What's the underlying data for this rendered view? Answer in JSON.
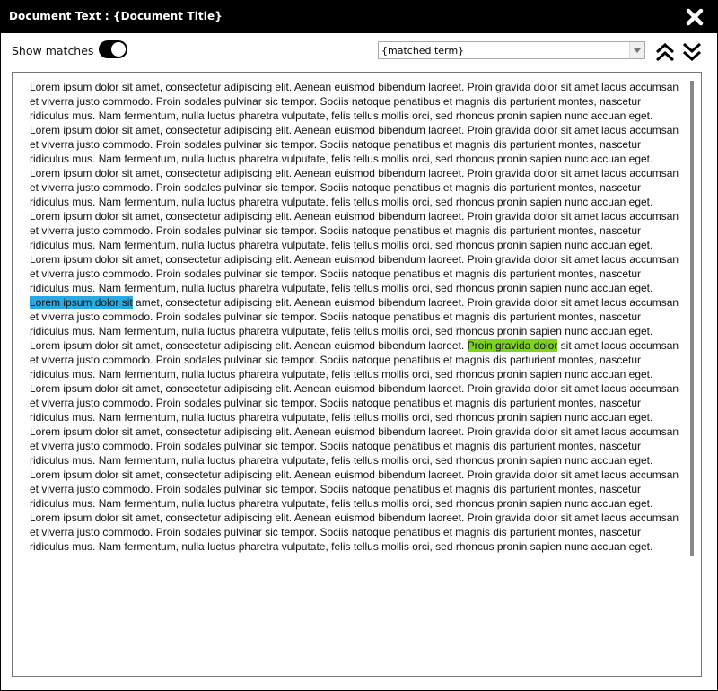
{
  "window": {
    "title": "Document Text : {Document Title}"
  },
  "toolbar": {
    "show_matches_label": "Show matches",
    "show_matches_on": true,
    "matched_term": "{matched term}"
  },
  "document": {
    "lorem_start": "Lorem ipsum dolor sit",
    "mid_a": " amet, consectetur adipiscing elit. Aenean euismod bibendum laoreet. ",
    "proin_gravida": "Proin gravida dolor",
    "mid_b": " sit amet lacus accumsan et viverra justo commodo. Proin sodales pulvinar sic tempor. Sociis natoque penatibus et magnis dis parturient montes, nascetur ridiculus mus. Nam fermentum, nulla luctus pharetra vulputate, felis tellus mollis orci, sed rhoncus pronin sapien nunc accuan eget.",
    "paragraph_count": 11,
    "highlights": [
      {
        "paragraph": 5,
        "phrase": "Lorem ipsum dolor sit",
        "color": "#29abe2"
      },
      {
        "paragraph": 6,
        "phrase": "Proin gravida dolor",
        "color": "#7ed321"
      }
    ]
  },
  "icons": {
    "close": "close-icon",
    "prev": "double-chevron-up-icon",
    "next": "double-chevron-down-icon"
  }
}
